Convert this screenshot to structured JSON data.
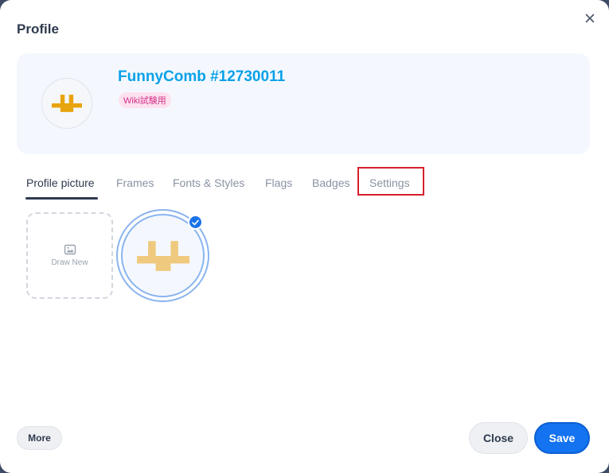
{
  "dialog": {
    "title": "Profile",
    "close_icon": "close-icon"
  },
  "profile": {
    "name": "FunnyComb #12730011",
    "badge": "Wiki試験用",
    "avatar_color": "#e8a40e",
    "name_color": "#0aa1e8",
    "badge_bg": "#fde1ef",
    "badge_color": "#d22f87"
  },
  "tabs": [
    {
      "label": "Profile picture",
      "active": true
    },
    {
      "label": "Frames",
      "active": false
    },
    {
      "label": "Fonts & Styles",
      "active": false
    },
    {
      "label": "Flags",
      "active": false
    },
    {
      "label": "Badges",
      "active": false
    },
    {
      "label": "Settings",
      "active": false,
      "highlighted": true
    }
  ],
  "pictures": {
    "draw_new_label": "Draw New",
    "draw_new_icon": "image-icon",
    "selected_icon": "checkmark-icon",
    "selected_avatar_color": "#efc97e"
  },
  "footer": {
    "more_label": "More",
    "close_label": "Close",
    "save_label": "Save"
  },
  "colors": {
    "accent": "#1473f0",
    "highlight": "#d61f2c"
  }
}
